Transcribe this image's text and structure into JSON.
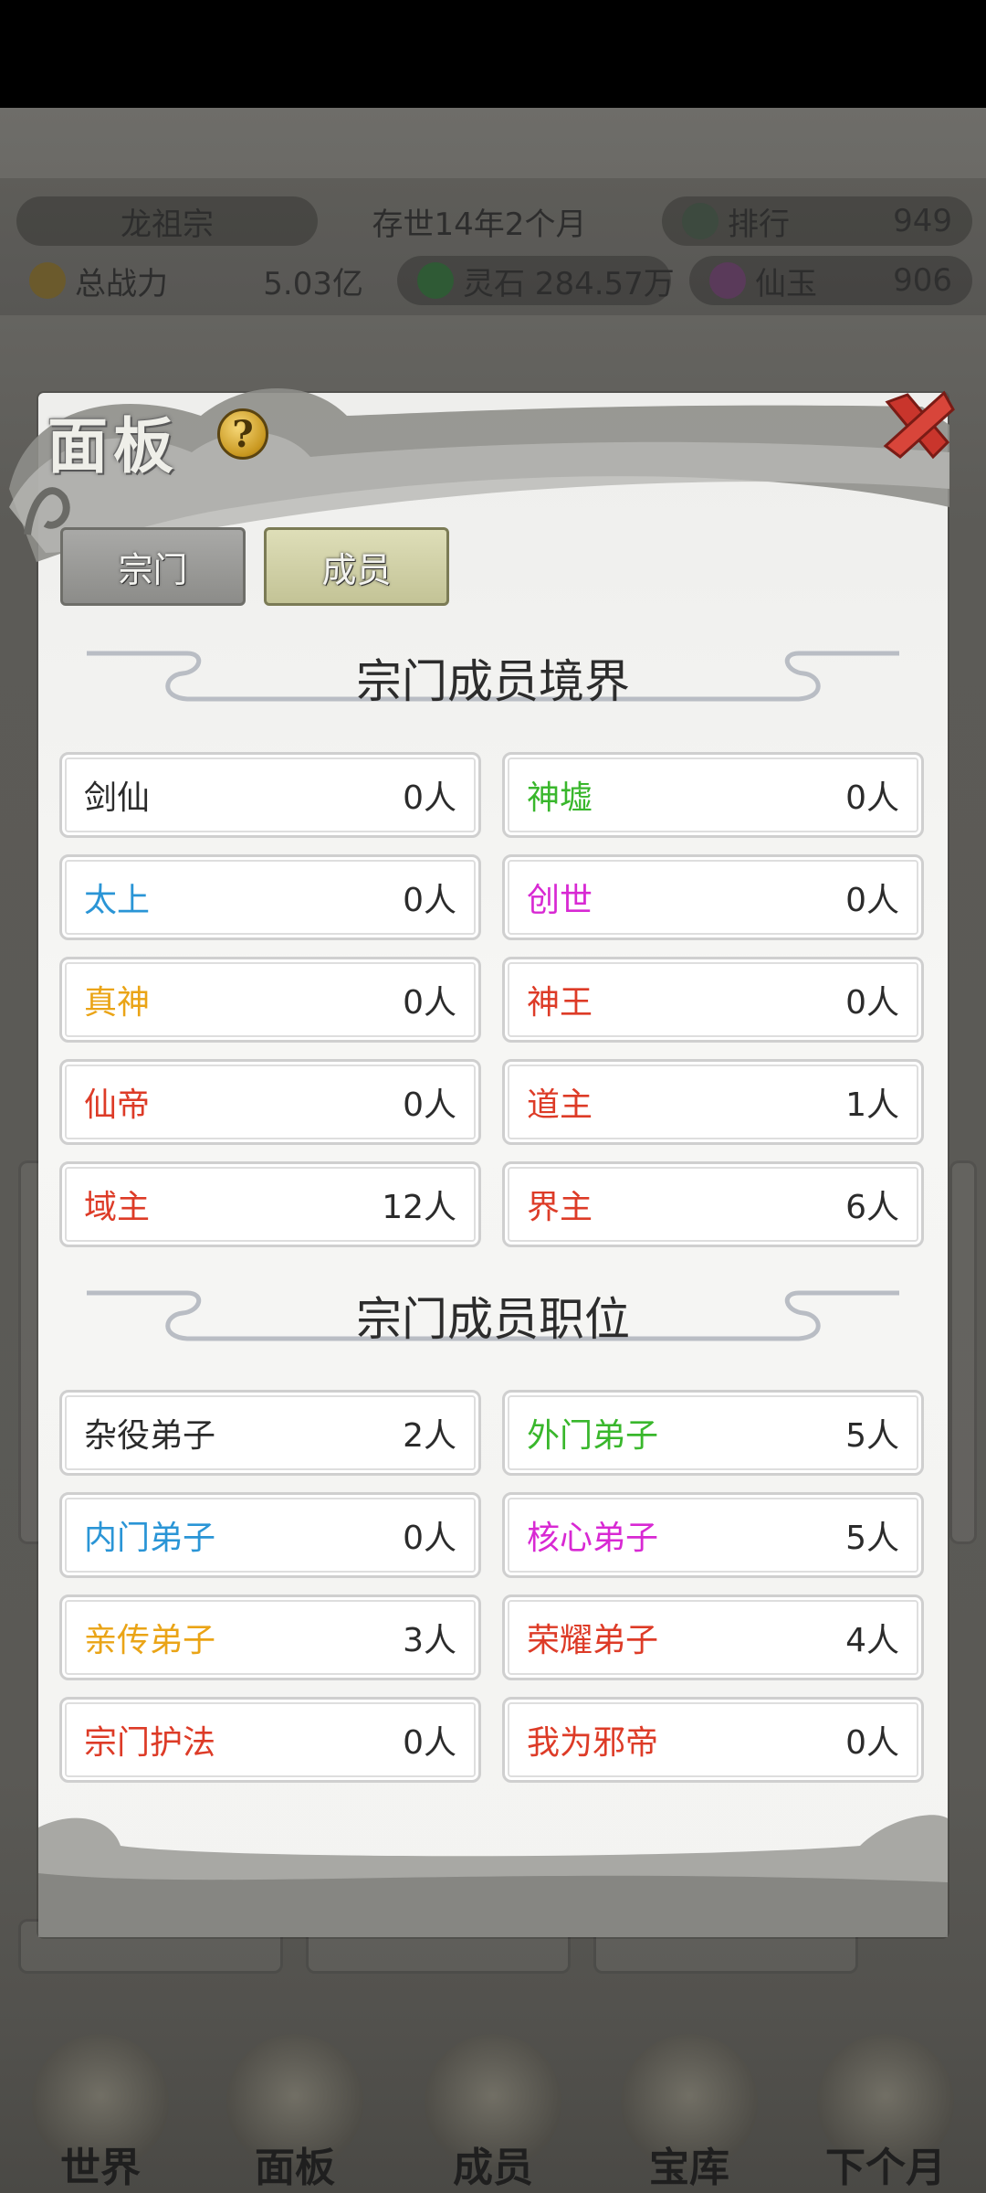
{
  "header": {
    "sect_name": "龙祖宗",
    "age": "存世14年2个月",
    "rank_label": "排行",
    "rank_value": "949",
    "power_label": "总战力",
    "power_value": "5.03亿",
    "spirit_stone": "灵石 284.57万",
    "jade_label": "仙玉",
    "jade_value": "906"
  },
  "panel": {
    "title": "面板",
    "help_glyph": "?",
    "tabs": [
      "宗门",
      "成员"
    ],
    "selected_tab": "成员",
    "realm_section_title": "宗门成员境界",
    "position_section_title": "宗门成员职位",
    "realms": [
      {
        "name": "剑仙",
        "count": "0人",
        "color": "#2b2b2b"
      },
      {
        "name": "神墟",
        "count": "0人",
        "color": "#39b72c"
      },
      {
        "name": "太上",
        "count": "0人",
        "color": "#2a95d6"
      },
      {
        "name": "创世",
        "count": "0人",
        "color": "#d829d3"
      },
      {
        "name": "真神",
        "count": "0人",
        "color": "#eaa416"
      },
      {
        "name": "神王",
        "count": "0人",
        "color": "#dd3b27"
      },
      {
        "name": "仙帝",
        "count": "0人",
        "color": "#dd3b27"
      },
      {
        "name": "道主",
        "count": "1人",
        "color": "#dd3b27"
      },
      {
        "name": "域主",
        "count": "12人",
        "color": "#dd3b27"
      },
      {
        "name": "界主",
        "count": "6人",
        "color": "#dd3b27"
      }
    ],
    "positions": [
      {
        "name": "杂役弟子",
        "count": "2人",
        "color": "#2b2b2b"
      },
      {
        "name": "外门弟子",
        "count": "5人",
        "color": "#39b72c"
      },
      {
        "name": "内门弟子",
        "count": "0人",
        "color": "#2a95d6"
      },
      {
        "name": "核心弟子",
        "count": "5人",
        "color": "#d829d3"
      },
      {
        "name": "亲传弟子",
        "count": "3人",
        "color": "#eaa416"
      },
      {
        "name": "荣耀弟子",
        "count": "4人",
        "color": "#dd3b27"
      },
      {
        "name": "宗门护法",
        "count": "0人",
        "color": "#dd3b27"
      },
      {
        "name": "我为邪帝",
        "count": "0人",
        "color": "#dd3b27"
      }
    ]
  },
  "bottom_nav": [
    "世界",
    "面板",
    "成员",
    "宝库",
    "下个月"
  ]
}
